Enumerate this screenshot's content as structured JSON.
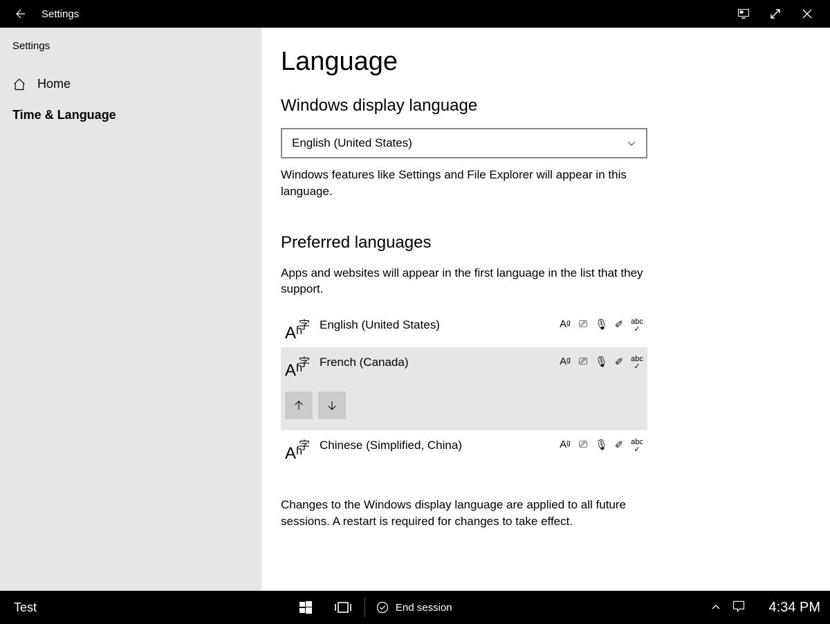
{
  "titlebar": {
    "back_aria": "Back",
    "title": "Settings"
  },
  "sidebar": {
    "app_name": "Settings",
    "home_label": "Home",
    "category_label": "Time & Language"
  },
  "page": {
    "heading": "Language",
    "display_section_title": "Windows display language",
    "display_dropdown_value": "English (United States)",
    "display_helper": "Windows features like Settings and File Explorer will appear in this language.",
    "preferred_section_title": "Preferred languages",
    "preferred_helper": "Apps and websites will appear in the first language in the list that they support.",
    "languages": [
      {
        "name": "English (United States)"
      },
      {
        "name": "French (Canada)"
      },
      {
        "name": "Chinese (Simplified, China)"
      }
    ],
    "footer_note": "Changes to the Windows display language are applied to all future sessions. A restart is required for changes to take effect."
  },
  "taskbar": {
    "user": "Test",
    "end_session_label": "End session",
    "clock": "4:34 PM"
  }
}
